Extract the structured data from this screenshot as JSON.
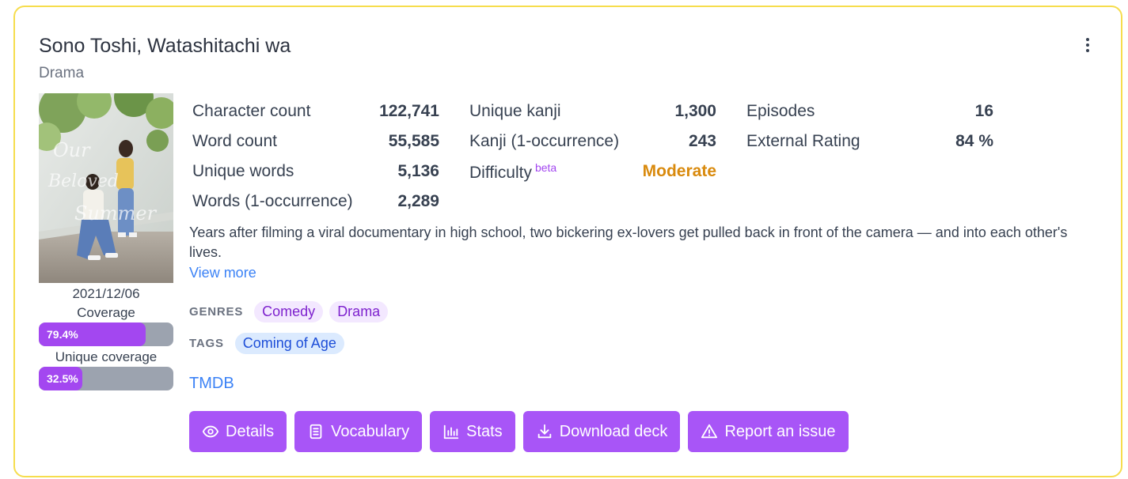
{
  "title": "Sono Toshi, Watashitachi wa",
  "category": "Drama",
  "release_date": "2021/12/06",
  "coverage": {
    "label": "Coverage",
    "value_text": "79.4%",
    "value": 79.4
  },
  "unique_coverage": {
    "label": "Unique coverage",
    "value_text": "32.5%",
    "value": 32.5
  },
  "stats": {
    "col1": [
      {
        "label": "Character count",
        "value": "122,741"
      },
      {
        "label": "Word count",
        "value": "55,585"
      },
      {
        "label": "Unique words",
        "value": "5,136"
      },
      {
        "label": "Words (1-occurrence)",
        "value": "2,289"
      }
    ],
    "col2": [
      {
        "label": "Unique kanji",
        "value": "1,300"
      },
      {
        "label": "Kanji (1-occurrence)",
        "value": "243"
      },
      {
        "label": "Difficulty",
        "beta": "beta",
        "value": "Moderate"
      }
    ],
    "col3": [
      {
        "label": "Episodes",
        "value": "16"
      },
      {
        "label": "External Rating",
        "value": "84 %"
      }
    ]
  },
  "description": "Years after filming a viral documentary in high school, two bickering ex-lovers get pulled back in front of the camera — and into each other's lives.",
  "view_more": "View more",
  "genres": {
    "label": "GENRES",
    "items": [
      "Comedy",
      "Drama"
    ]
  },
  "tags": {
    "label": "TAGS",
    "items": [
      "Coming of Age"
    ]
  },
  "external_link": "TMDB",
  "actions": {
    "details": "Details",
    "vocabulary": "Vocabulary",
    "stats": "Stats",
    "download": "Download deck",
    "report": "Report an issue"
  },
  "colors": {
    "accent": "#a855f7",
    "card_border": "#f6dd4d",
    "difficulty_moderate": "#d98a0d",
    "link": "#3b82f6"
  },
  "icons": {
    "menu": "more-vertical-icon",
    "details": "eye-icon",
    "vocabulary": "document-list-icon",
    "stats": "bar-chart-icon",
    "download": "download-icon",
    "report": "warning-triangle-icon"
  }
}
